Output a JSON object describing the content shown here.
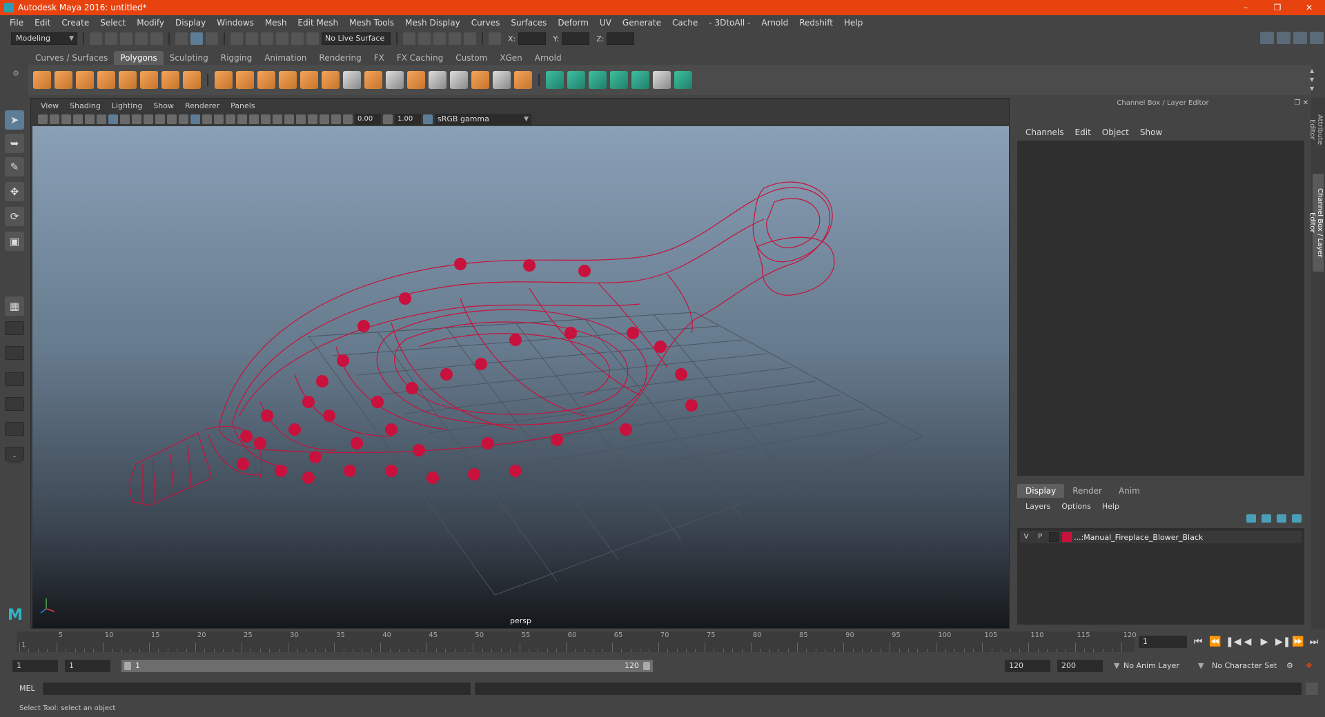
{
  "title": "Autodesk Maya 2016: untitled*",
  "menubar": [
    "File",
    "Edit",
    "Create",
    "Select",
    "Modify",
    "Display",
    "Windows",
    "Mesh",
    "Edit Mesh",
    "Mesh Tools",
    "Mesh Display",
    "Curves",
    "Surfaces",
    "Deform",
    "UV",
    "Generate",
    "Cache",
    "- 3DtoAll -",
    "Arnold",
    "Redshift",
    "Help"
  ],
  "statusline": {
    "mode": "Modeling",
    "live_surface": "No Live Surface",
    "x_label": "X:",
    "y_label": "Y:",
    "z_label": "Z:"
  },
  "shelf_tabs": [
    "Curves / Surfaces",
    "Polygons",
    "Sculpting",
    "Rigging",
    "Animation",
    "Rendering",
    "FX",
    "FX Caching",
    "Custom",
    "XGen",
    "Arnold"
  ],
  "shelf_active": "Polygons",
  "viewport": {
    "menu": [
      "View",
      "Shading",
      "Lighting",
      "Show",
      "Renderer",
      "Panels"
    ],
    "exposure": "0.00",
    "gamma_value": "1.00",
    "color_space": "sRGB gamma",
    "camera": "persp"
  },
  "channel_box": {
    "title": "Channel Box / Layer Editor",
    "menu": [
      "Channels",
      "Edit",
      "Object",
      "Show"
    ]
  },
  "layer_editor": {
    "tabs": [
      "Display",
      "Render",
      "Anim"
    ],
    "active_tab": "Display",
    "menu": [
      "Layers",
      "Options",
      "Help"
    ],
    "layers": [
      {
        "v": "V",
        "p": "P",
        "name": "...:Manual_Fireplace_Blower_Black",
        "color": "#c8113c"
      }
    ]
  },
  "side_tabs": [
    "Attribute Editor",
    "Channel Box / Layer Editor"
  ],
  "timeslider": {
    "ticks": [
      1,
      5,
      10,
      15,
      20,
      25,
      30,
      35,
      40,
      45,
      50,
      55,
      60,
      65,
      70,
      75,
      80,
      85,
      90,
      95,
      100,
      105,
      110,
      115,
      120
    ],
    "current_frame": "1"
  },
  "range": {
    "start": "1",
    "playback_start": "1",
    "range_start": "1",
    "range_end": "120",
    "playback_end": "120",
    "end": "200",
    "anim_layer": "No Anim Layer",
    "char_set": "No Character Set"
  },
  "command": {
    "label": "MEL"
  },
  "help_line": "Select Tool: select an object",
  "colors": {
    "titlebar": "#e8420e",
    "wireframe": "#c8113c"
  }
}
